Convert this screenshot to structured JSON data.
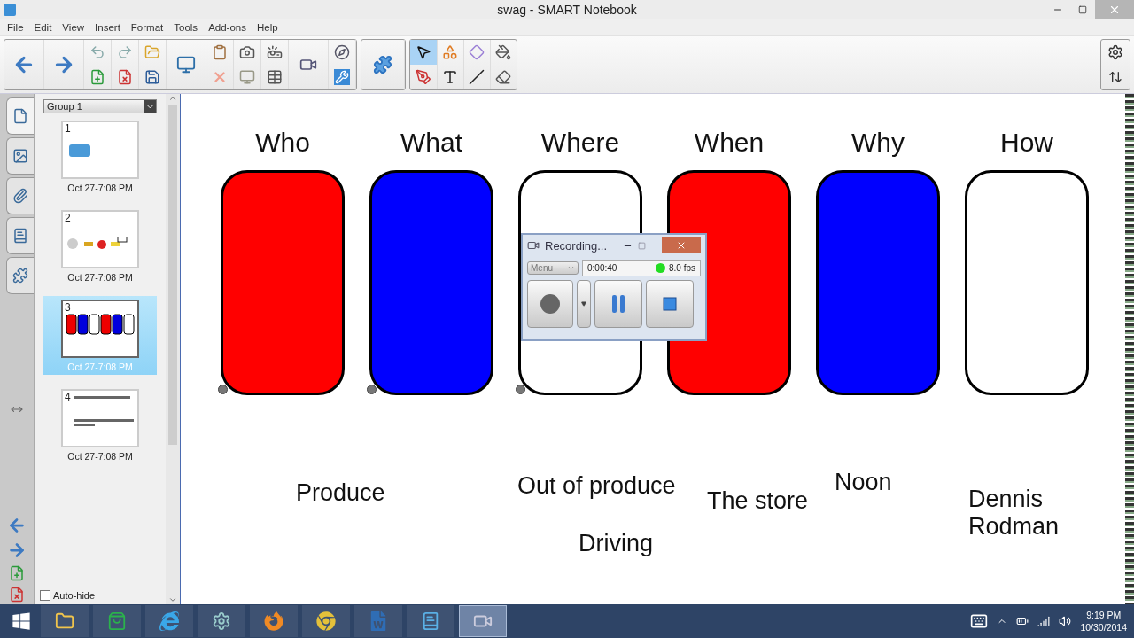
{
  "window": {
    "title": "swag - SMART Notebook"
  },
  "menu": [
    "File",
    "Edit",
    "View",
    "Insert",
    "Format",
    "Tools",
    "Add-ons",
    "Help"
  ],
  "tools": [
    {
      "kind": "select",
      "selected": true
    },
    {
      "kind": "shapes",
      "selected": false
    },
    {
      "kind": "fill-shape",
      "selected": false
    },
    {
      "kind": "fill",
      "selected": false
    },
    {
      "kind": "pens",
      "selected": false
    },
    {
      "kind": "text",
      "selected": false
    },
    {
      "kind": "line",
      "selected": false
    },
    {
      "kind": "eraser",
      "selected": false
    }
  ],
  "sidebar": {
    "tabs": [
      {
        "kind": "pages",
        "selected": true
      },
      {
        "kind": "gallery",
        "selected": false
      },
      {
        "kind": "attachments",
        "selected": false
      },
      {
        "kind": "properties",
        "selected": false
      },
      {
        "kind": "addons",
        "selected": false
      }
    ],
    "group": "Group 1",
    "pages": [
      {
        "number": "1",
        "time": "Oct 27-7:08 PM",
        "selected": false,
        "kind": "book"
      },
      {
        "number": "2",
        "time": "Oct 27-7:08 PM",
        "selected": false,
        "kind": "items"
      },
      {
        "number": "3",
        "time": "Oct 27-7:08 PM",
        "selected": true,
        "kind": "cards"
      },
      {
        "number": "4",
        "time": "Oct 27-7:08 PM",
        "selected": false,
        "kind": "lines"
      }
    ],
    "auto_hide": {
      "label": "Auto-hide",
      "checked": false
    }
  },
  "canvas": {
    "columns": [
      {
        "heading": "Who",
        "color": "#ff0000",
        "marker": true
      },
      {
        "heading": "What",
        "color": "#0000ff",
        "marker": true
      },
      {
        "heading": "Where",
        "color": "#ffffff",
        "marker": true
      },
      {
        "heading": "When",
        "color": "#ff0000",
        "marker": false
      },
      {
        "heading": "Why",
        "color": "#0000ff",
        "marker": false
      },
      {
        "heading": "How",
        "color": "#ffffff",
        "marker": false
      }
    ],
    "answers": [
      "Produce",
      "Out of produce",
      "Driving",
      "The store",
      "Noon",
      "Dennis Rodman"
    ]
  },
  "recorder": {
    "title": "Recording...",
    "menu": "Menu",
    "time": "0:00:40",
    "fps": "8.0 fps",
    "recording": true
  },
  "taskbar": {
    "apps": [
      {
        "kind": "explorer",
        "active": false
      },
      {
        "kind": "store",
        "active": false
      },
      {
        "kind": "ie",
        "active": false
      },
      {
        "kind": "control",
        "active": false
      },
      {
        "kind": "firefox",
        "active": false
      },
      {
        "kind": "chrome",
        "active": false
      },
      {
        "kind": "word",
        "active": false
      },
      {
        "kind": "notebook",
        "active": false
      },
      {
        "kind": "recorder",
        "active": true
      }
    ],
    "time": "9:19 PM",
    "date": "10/30/2014"
  }
}
